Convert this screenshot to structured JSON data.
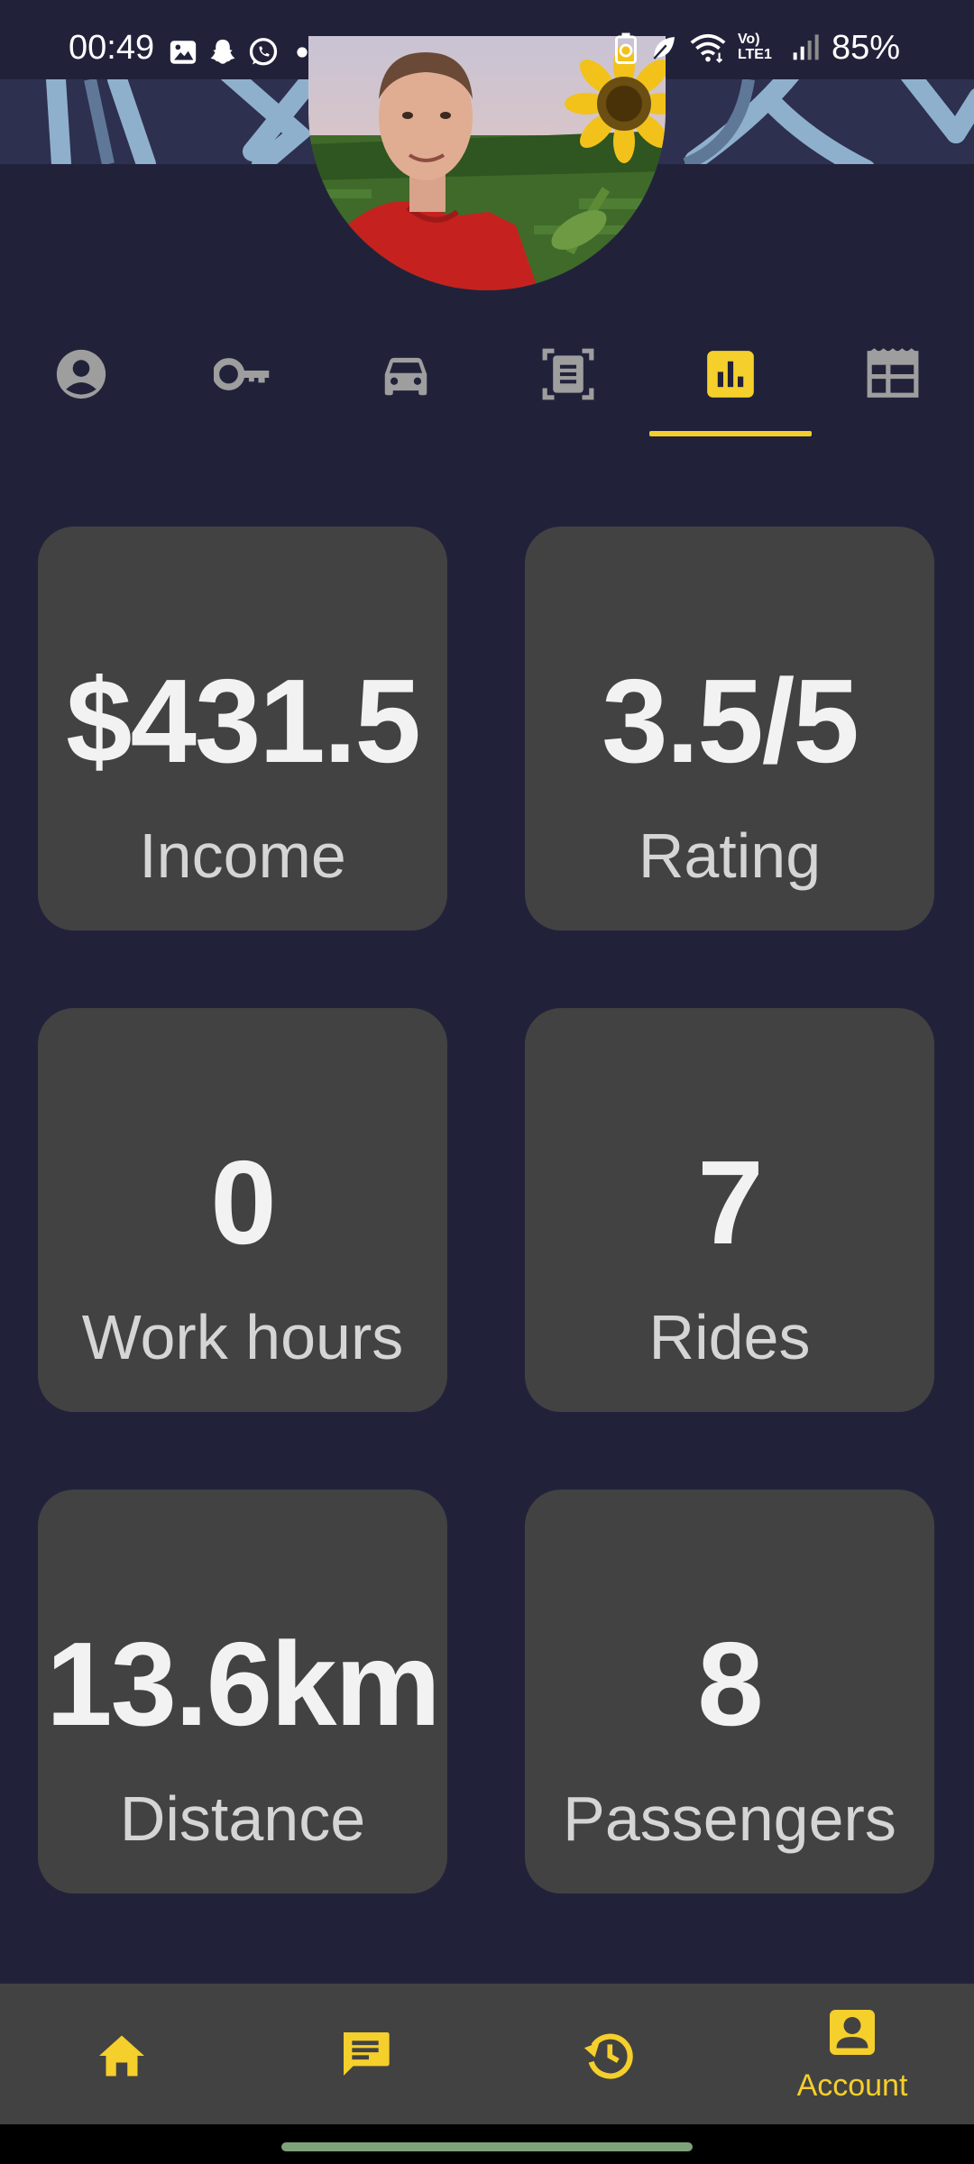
{
  "status_bar": {
    "time": "00:49",
    "battery": "85%",
    "network": "Vo) LTE1",
    "notification_icons": [
      "gallery-icon",
      "snapchat-icon",
      "whatsapp-icon",
      "dot-icon"
    ],
    "system_icons": [
      "battery-saver-icon",
      "leaf-icon",
      "wifi-icon",
      "lte-icon",
      "signal-icon"
    ]
  },
  "profile": {
    "avatar_icon": "profile-photo"
  },
  "tabs": [
    {
      "icon": "person-icon",
      "active": false
    },
    {
      "icon": "key-icon",
      "active": false
    },
    {
      "icon": "car-icon",
      "active": false
    },
    {
      "icon": "document-scan-icon",
      "active": false
    },
    {
      "icon": "bar-chart-icon",
      "active": true
    },
    {
      "icon": "calendar-table-icon",
      "active": false
    }
  ],
  "stats": [
    {
      "value": "$431.5",
      "label": "Income"
    },
    {
      "value": "3.5/5",
      "label": "Rating"
    },
    {
      "value": "0",
      "label": "Work hours"
    },
    {
      "value": "7",
      "label": "Rides"
    },
    {
      "value": "13.6km",
      "label": "Distance"
    },
    {
      "value": "8",
      "label": "Passengers"
    }
  ],
  "bottom_nav": [
    {
      "icon": "home-icon",
      "label": ""
    },
    {
      "icon": "chat-icon",
      "label": ""
    },
    {
      "icon": "history-icon",
      "label": ""
    },
    {
      "icon": "account-icon",
      "label": "Account",
      "active": true
    }
  ],
  "colors": {
    "background": "#21223a",
    "banner": "#2e3050",
    "card": "#424242",
    "accent": "#f5cf2b",
    "inactive_icon": "#9e9e9e"
  }
}
